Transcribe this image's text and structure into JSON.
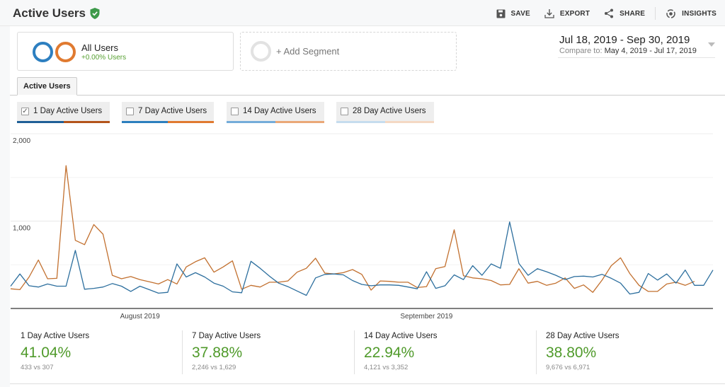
{
  "header": {
    "title": "Active Users",
    "verified_icon": "shield-check-icon",
    "actions": [
      {
        "label": "SAVE",
        "icon": "floppy-disk-icon"
      },
      {
        "label": "EXPORT",
        "icon": "download-icon"
      },
      {
        "label": "SHARE",
        "icon": "share-icon"
      },
      {
        "label": "INSIGHTS",
        "icon": "insights-icon"
      }
    ]
  },
  "segments": {
    "all_users": {
      "name": "All Users",
      "sub": "+0.00% Users"
    },
    "add_segment": "+ Add Segment"
  },
  "date_range": {
    "main": "Jul 18, 2019 - Sep 30, 2019",
    "compare_label": "Compare to:",
    "compare_value": "May 4, 2019 - Jul 17, 2019"
  },
  "tabs": [
    {
      "label": "Active Users",
      "active": true
    }
  ],
  "metric_toggles": [
    {
      "label": "1 Day Active Users",
      "checked": true,
      "colors": [
        "#1f5f96",
        "#b3531a"
      ]
    },
    {
      "label": "7 Day Active Users",
      "checked": false,
      "colors": [
        "#2c7fbe",
        "#e07a30"
      ]
    },
    {
      "label": "14 Day Active Users",
      "checked": false,
      "colors": [
        "#74acd9",
        "#eaa878"
      ]
    },
    {
      "label": "28 Day Active Users",
      "checked": false,
      "colors": [
        "#c6dcee",
        "#f4d8c4"
      ]
    }
  ],
  "colors": {
    "current": "#2d6f9e",
    "previous": "#c2702f",
    "positive": "#4f9a2a"
  },
  "chart_data": {
    "type": "line",
    "title": "1 Day Active Users",
    "xlabel": "",
    "ylabel": "",
    "ylim": [
      0,
      2000
    ],
    "yticks": [
      "1,000",
      "2,000"
    ],
    "ytick_values": [
      1000,
      2000
    ],
    "xtick_labels": [
      {
        "label": "August 2019",
        "index": 14
      },
      {
        "label": "September 2019",
        "index": 45
      }
    ],
    "grid": true,
    "legend": "none",
    "series": [
      {
        "name": "Jul 18, 2019 - Sep 30, 2019",
        "color": "#2d6f9e",
        "values": [
          255,
          395,
          260,
          245,
          280,
          255,
          255,
          665,
          220,
          230,
          245,
          285,
          255,
          195,
          255,
          215,
          175,
          185,
          510,
          360,
          410,
          360,
          290,
          255,
          190,
          180,
          540,
          460,
          370,
          290,
          250,
          200,
          150,
          350,
          390,
          395,
          385,
          320,
          275,
          260,
          270,
          270,
          265,
          245,
          225,
          420,
          230,
          260,
          385,
          330,
          490,
          380,
          510,
          460,
          990,
          515,
          380,
          455,
          420,
          380,
          330,
          365,
          370,
          360,
          390,
          345,
          290,
          165,
          185,
          400,
          325,
          395,
          290,
          440,
          265,
          265,
          440
        ]
      },
      {
        "name": "May 4, 2019 - Jul 17, 2019",
        "color": "#c2702f",
        "values": [
          225,
          215,
          360,
          555,
          340,
          345,
          1635,
          780,
          730,
          960,
          850,
          380,
          340,
          365,
          330,
          305,
          280,
          330,
          280,
          475,
          535,
          580,
          415,
          475,
          545,
          220,
          265,
          245,
          300,
          300,
          315,
          415,
          460,
          575,
          405,
          395,
          410,
          445,
          390,
          210,
          315,
          310,
          300,
          300,
          240,
          250,
          455,
          480,
          900,
          375,
          350,
          340,
          320,
          270,
          275,
          455,
          290,
          310,
          265,
          290,
          350,
          230,
          270,
          185,
          325,
          490,
          580,
          400,
          265,
          195,
          195,
          280,
          300,
          265,
          310
        ]
      }
    ]
  },
  "metrics": [
    {
      "name": "1 Day Active Users",
      "value": "41.04%",
      "compare": "433 vs 307"
    },
    {
      "name": "7 Day Active Users",
      "value": "37.88%",
      "compare": "2,246 vs 1,629"
    },
    {
      "name": "14 Day Active Users",
      "value": "22.94%",
      "compare": "4,121 vs 3,352"
    },
    {
      "name": "28 Day Active Users",
      "value": "38.80%",
      "compare": "9,676 vs 6,971"
    }
  ]
}
